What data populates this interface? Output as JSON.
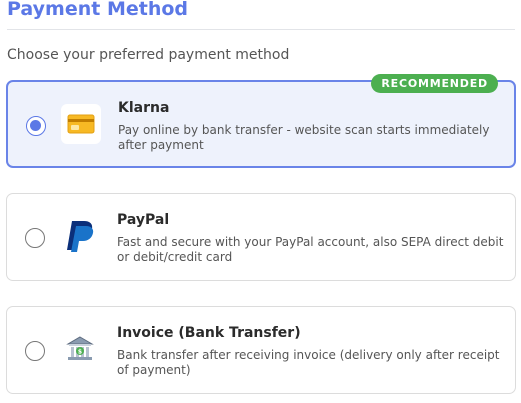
{
  "page": {
    "heading": "Payment Method",
    "subtitle": "Choose your preferred payment method"
  },
  "options": [
    {
      "title": "Klarna",
      "description": "Pay online by bank transfer - website scan starts immediately after payment",
      "badge": "RECOMMENDED",
      "selected": true,
      "icon": "credit-card-icon"
    },
    {
      "title": "PayPal",
      "description": "Fast and secure with your PayPal account, also SEPA direct debit or debit/credit card",
      "selected": false,
      "icon": "paypal-logo-icon"
    },
    {
      "title": "Invoice (Bank Transfer)",
      "description": "Bank transfer after receiving invoice (delivery only after receipt of payment)",
      "selected": false,
      "icon": "bank-icon"
    }
  ],
  "colors": {
    "accent": "#5b78e6",
    "selected_bg": "#eef2fc",
    "badge": "#4caf50"
  }
}
